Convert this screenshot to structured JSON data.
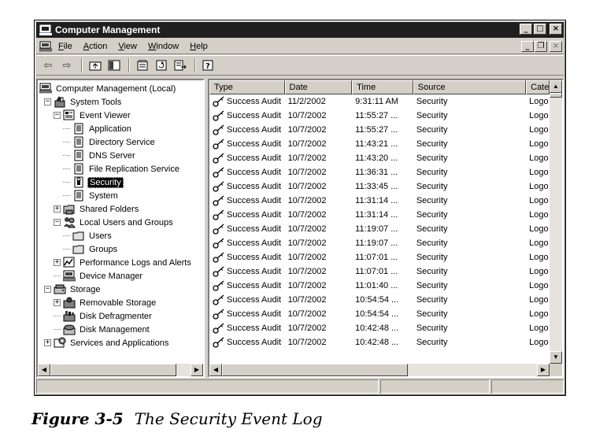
{
  "window": {
    "title": "Computer Management"
  },
  "menubar": {
    "items": [
      {
        "underline": "F",
        "rest": "ile"
      },
      {
        "underline": "A",
        "rest": "ction"
      },
      {
        "underline": "V",
        "rest": "iew"
      },
      {
        "underline": "W",
        "rest": "indow"
      },
      {
        "underline": "H",
        "rest": "elp"
      }
    ]
  },
  "tree": {
    "items": [
      {
        "label": "Computer Management (Local)",
        "level": 0,
        "expander": "",
        "icon": "computer-icon"
      },
      {
        "label": "System Tools",
        "level": 1,
        "expander": "−",
        "icon": "tools-icon"
      },
      {
        "label": "Event Viewer",
        "level": 2,
        "expander": "−",
        "icon": "event-viewer-icon"
      },
      {
        "label": "Application",
        "level": 3,
        "expander": "",
        "icon": "log-icon"
      },
      {
        "label": "Directory Service",
        "level": 3,
        "expander": "",
        "icon": "log-icon"
      },
      {
        "label": "DNS Server",
        "level": 3,
        "expander": "",
        "icon": "log-icon"
      },
      {
        "label": "File Replication Service",
        "level": 3,
        "expander": "",
        "icon": "log-icon"
      },
      {
        "label": "Security",
        "level": 3,
        "expander": "",
        "icon": "security-log-icon",
        "selected": true
      },
      {
        "label": "System",
        "level": 3,
        "expander": "",
        "icon": "log-icon"
      },
      {
        "label": "Shared Folders",
        "level": 2,
        "expander": "+",
        "icon": "shared-folders-icon"
      },
      {
        "label": "Local Users and Groups",
        "level": 2,
        "expander": "−",
        "icon": "users-groups-icon"
      },
      {
        "label": "Users",
        "level": 3,
        "expander": "",
        "icon": "folder-icon"
      },
      {
        "label": "Groups",
        "level": 3,
        "expander": "",
        "icon": "folder-icon"
      },
      {
        "label": "Performance Logs and Alerts",
        "level": 2,
        "expander": "+",
        "icon": "performance-icon"
      },
      {
        "label": "Device Manager",
        "level": 2,
        "expander": "",
        "icon": "device-manager-icon"
      },
      {
        "label": "Storage",
        "level": 1,
        "expander": "−",
        "icon": "storage-icon"
      },
      {
        "label": "Removable Storage",
        "level": 2,
        "expander": "+",
        "icon": "removable-storage-icon"
      },
      {
        "label": "Disk Defragmenter",
        "level": 2,
        "expander": "",
        "icon": "defrag-icon"
      },
      {
        "label": "Disk Management",
        "level": 2,
        "expander": "",
        "icon": "disk-management-icon"
      },
      {
        "label": "Services and Applications",
        "level": 1,
        "expander": "+",
        "icon": "services-icon"
      }
    ]
  },
  "list": {
    "columns": [
      "Type",
      "Date",
      "Time",
      "Source",
      "Cate"
    ],
    "rows": [
      {
        "type": "Success Audit",
        "date": "11/2/2002",
        "time": "9:31:11 AM",
        "source": "Security",
        "category": "Logo"
      },
      {
        "type": "Success Audit",
        "date": "10/7/2002",
        "time": "11:55:27 ...",
        "source": "Security",
        "category": "Logo"
      },
      {
        "type": "Success Audit",
        "date": "10/7/2002",
        "time": "11:55:27 ...",
        "source": "Security",
        "category": "Logo"
      },
      {
        "type": "Success Audit",
        "date": "10/7/2002",
        "time": "11:43:21 ...",
        "source": "Security",
        "category": "Logo"
      },
      {
        "type": "Success Audit",
        "date": "10/7/2002",
        "time": "11:43:20 ...",
        "source": "Security",
        "category": "Logo"
      },
      {
        "type": "Success Audit",
        "date": "10/7/2002",
        "time": "11:36:31 ...",
        "source": "Security",
        "category": "Logo"
      },
      {
        "type": "Success Audit",
        "date": "10/7/2002",
        "time": "11:33:45 ...",
        "source": "Security",
        "category": "Logo"
      },
      {
        "type": "Success Audit",
        "date": "10/7/2002",
        "time": "11:31:14 ...",
        "source": "Security",
        "category": "Logo"
      },
      {
        "type": "Success Audit",
        "date": "10/7/2002",
        "time": "11:31:14 ...",
        "source": "Security",
        "category": "Logo"
      },
      {
        "type": "Success Audit",
        "date": "10/7/2002",
        "time": "11:19:07 ...",
        "source": "Security",
        "category": "Logo"
      },
      {
        "type": "Success Audit",
        "date": "10/7/2002",
        "time": "11:19:07 ...",
        "source": "Security",
        "category": "Logo"
      },
      {
        "type": "Success Audit",
        "date": "10/7/2002",
        "time": "11:07:01 ...",
        "source": "Security",
        "category": "Logo"
      },
      {
        "type": "Success Audit",
        "date": "10/7/2002",
        "time": "11:07:01 ...",
        "source": "Security",
        "category": "Logo"
      },
      {
        "type": "Success Audit",
        "date": "10/7/2002",
        "time": "11:01:40 ...",
        "source": "Security",
        "category": "Logo"
      },
      {
        "type": "Success Audit",
        "date": "10/7/2002",
        "time": "10:54:54 ...",
        "source": "Security",
        "category": "Logo"
      },
      {
        "type": "Success Audit",
        "date": "10/7/2002",
        "time": "10:54:54 ...",
        "source": "Security",
        "category": "Logo"
      },
      {
        "type": "Success Audit",
        "date": "10/7/2002",
        "time": "10:42:48 ...",
        "source": "Security",
        "category": "Logo"
      },
      {
        "type": "Success Audit",
        "date": "10/7/2002",
        "time": "10:42:48 ...",
        "source": "Security",
        "category": "Logo"
      }
    ]
  },
  "caption": {
    "number": "Figure 3-5",
    "text": "The Security Event Log"
  }
}
